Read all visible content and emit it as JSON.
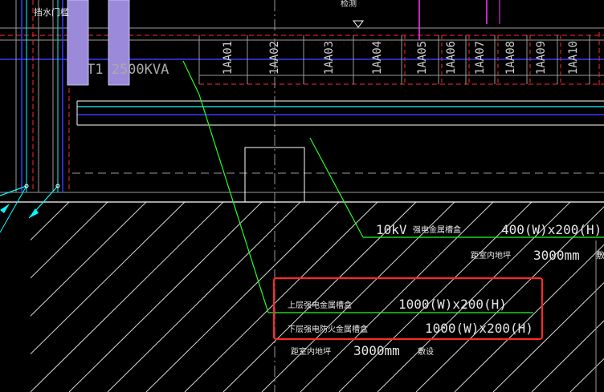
{
  "colors": {
    "background": "#000000",
    "white_line": "#ffffff",
    "grey_line": "#9a9a9a",
    "blue_line": "#3a3aff",
    "cyan_line": "#00ffff",
    "red_dash": "#ff2a2a",
    "green_leader": "#22ff22",
    "magenta_line": "#ff33ff",
    "purple_fill": "#9b8ad9",
    "highlight_box": "#ff2a2a",
    "text": "#e6e6e6"
  },
  "top_labels": {
    "left_label": "挡水门槛",
    "center_label": "检测"
  },
  "transformer_label": "T1 2500KVA",
  "panels": [
    "1AA01",
    "1AA02",
    "1AA03",
    "1AA04",
    "1AA05",
    "1AA06",
    "1AA07",
    "1AA08",
    "1AA09",
    "1AA10"
  ],
  "annotation_10kv": {
    "voltage": "10kV",
    "tray_name": "强电金属槽盒",
    "size": "400(W)x200(H)",
    "height_label": "距室内地坪",
    "height_value": "3000mm",
    "tail": "敷"
  },
  "annotation_box": {
    "upper_name": "上层强电金属槽盒",
    "upper_size": "1000(W)x200(H)",
    "lower_name": "下层强电防火金属槽盒",
    "lower_size": "1000(W)x200(H)"
  },
  "annotation_bottom": {
    "height_label": "距室内地坪",
    "height_value": "3000mm",
    "tail": "敷设"
  }
}
